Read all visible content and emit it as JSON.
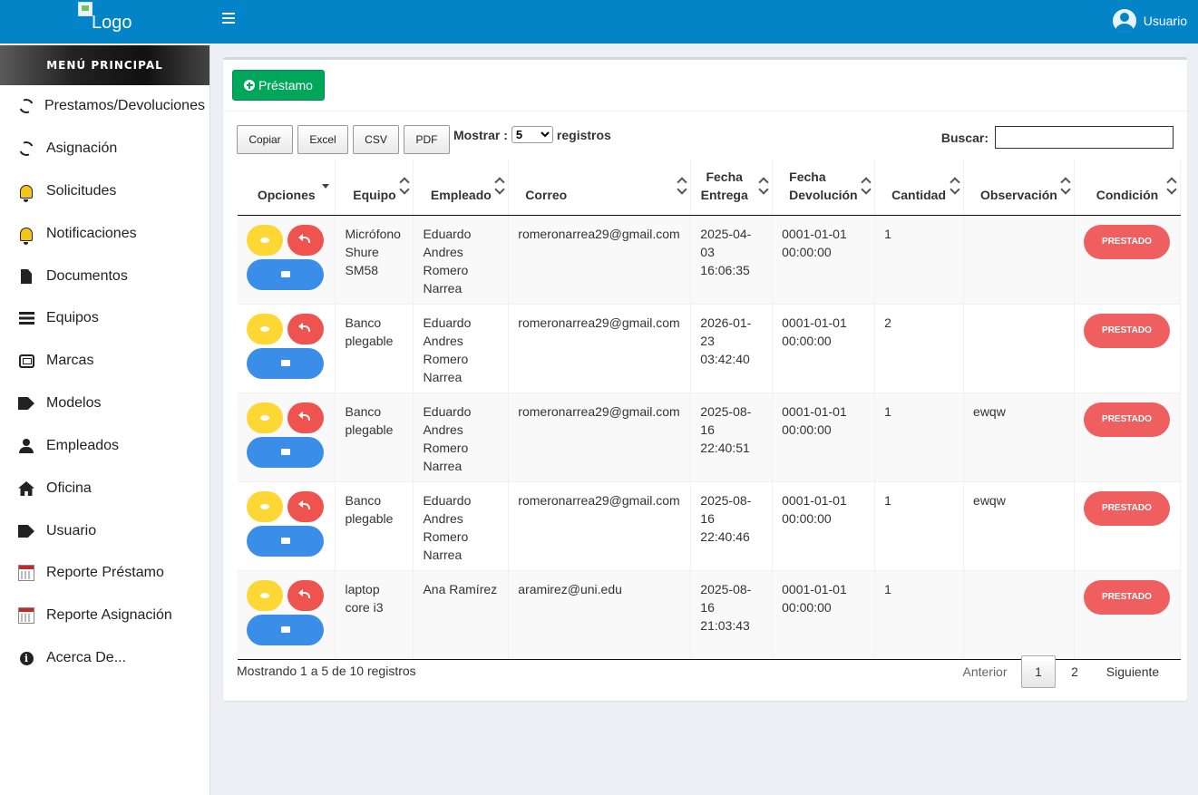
{
  "header": {
    "logo_alt": "Logo",
    "user_label": "Usuario"
  },
  "sidebar": {
    "title": "MENÚ PRINCIPAL",
    "items": [
      {
        "label": "Prestamos/Devoluciones",
        "icon": "sync-icon"
      },
      {
        "label": "Asignación",
        "icon": "sync-icon"
      },
      {
        "label": "Solicitudes",
        "icon": "bell-icon"
      },
      {
        "label": "Notificaciones",
        "icon": "bell-icon"
      },
      {
        "label": "Documentos",
        "icon": "file-icon"
      },
      {
        "label": "Equipos",
        "icon": "list-icon"
      },
      {
        "label": "Marcas",
        "icon": "box-icon"
      },
      {
        "label": "Modelos",
        "icon": "tags-icon"
      },
      {
        "label": "Empleados",
        "icon": "user-icon"
      },
      {
        "label": "Oficina",
        "icon": "home-icon"
      },
      {
        "label": "Usuario",
        "icon": "tags-icon"
      },
      {
        "label": "Reporte Préstamo",
        "icon": "calendar-icon"
      },
      {
        "label": "Reporte Asignación",
        "icon": "calendar-icon"
      },
      {
        "label": "Acerca De...",
        "icon": "info-icon"
      }
    ]
  },
  "toolbar": {
    "new_button": "Préstamo",
    "export": [
      "Copiar",
      "Excel",
      "CSV",
      "PDF"
    ],
    "show_label": "Mostrar :",
    "show_value": "5",
    "show_suffix": "registros",
    "search_label": "Buscar:",
    "search_value": ""
  },
  "table": {
    "headers": [
      "Opciones",
      "Equipo",
      "Empleado",
      "Correo",
      "Fecha Entrega",
      "Fecha Devolución",
      "Cantidad",
      "Observación",
      "Condición"
    ],
    "rows": [
      {
        "equipo": "Micrófono Shure SM58",
        "empleado": "Eduardo Andres Romero Narrea",
        "correo": "romeronarrea29@gmail.com",
        "entrega": "2025-04-03 16:06:35",
        "devolucion": "0001-01-01 00:00:00",
        "cantidad": "1",
        "observacion": "",
        "condicion": "PRESTADO"
      },
      {
        "equipo": "Banco plegable",
        "empleado": "Eduardo Andres Romero Narrea",
        "correo": "romeronarrea29@gmail.com",
        "entrega": "2026-01-23 03:42:40",
        "devolucion": "0001-01-01 00:00:00",
        "cantidad": "2",
        "observacion": "",
        "condicion": "PRESTADO"
      },
      {
        "equipo": "Banco plegable",
        "empleado": "Eduardo Andres Romero Narrea",
        "correo": "romeronarrea29@gmail.com",
        "entrega": "2025-08-16 22:40:51",
        "devolucion": "0001-01-01 00:00:00",
        "cantidad": "1",
        "observacion": "ewqw",
        "condicion": "PRESTADO"
      },
      {
        "equipo": "Banco plegable",
        "empleado": "Eduardo Andres Romero Narrea",
        "correo": "romeronarrea29@gmail.com",
        "entrega": "2025-08-16 22:40:46",
        "devolucion": "0001-01-01 00:00:00",
        "cantidad": "1",
        "observacion": "ewqw",
        "condicion": "PRESTADO"
      },
      {
        "equipo": "laptop core i3",
        "empleado": "Ana Ramírez",
        "correo": "aramirez@uni.edu",
        "entrega": "2025-08-16 21:03:43",
        "devolucion": "0001-01-01 00:00:00",
        "cantidad": "1",
        "observacion": "",
        "condicion": "PRESTADO"
      }
    ]
  },
  "footer": {
    "info": "Mostrando 1 a 5 de 10 registros",
    "prev": "Anterior",
    "pages": [
      "1",
      "2"
    ],
    "next": "Siguiente"
  }
}
